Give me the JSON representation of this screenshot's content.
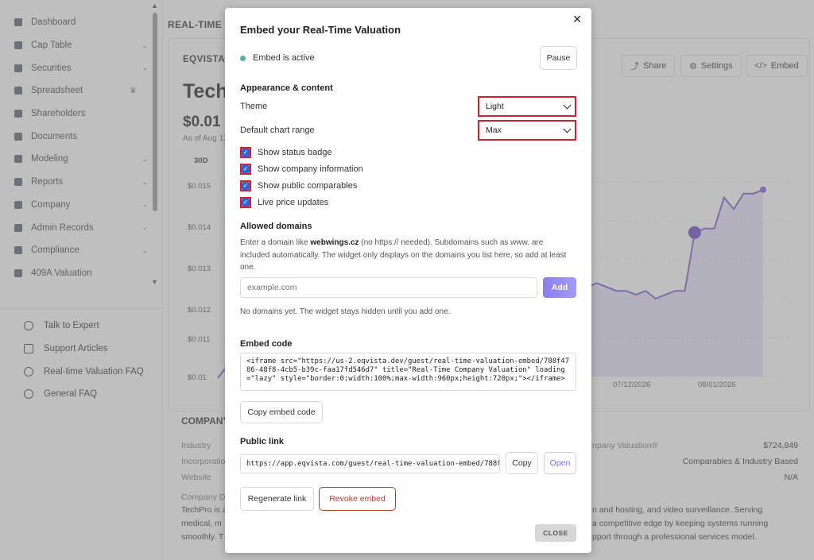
{
  "sidebar": {
    "items": [
      {
        "label": "Dashboard",
        "chevron": false
      },
      {
        "label": "Cap Table",
        "chevron": true
      },
      {
        "label": "Securities",
        "chevron": true
      },
      {
        "label": "Spreadsheet",
        "chevron": false,
        "crown": true
      },
      {
        "label": "Shareholders",
        "chevron": false
      },
      {
        "label": "Documents",
        "chevron": false
      },
      {
        "label": "Modeling",
        "chevron": true
      },
      {
        "label": "Reports",
        "chevron": true
      },
      {
        "label": "Company",
        "chevron": true
      },
      {
        "label": "Admin Records",
        "chevron": true
      },
      {
        "label": "Compliance",
        "chevron": true
      },
      {
        "label": "409A Valuation",
        "chevron": false
      }
    ],
    "help": [
      {
        "label": "Talk to Expert",
        "icon": "headset-icon"
      },
      {
        "label": "Support Articles",
        "icon": "book-icon"
      },
      {
        "label": "Real-time Valuation FAQ",
        "icon": "question-icon"
      },
      {
        "label": "General FAQ",
        "icon": "question-icon"
      }
    ]
  },
  "main": {
    "title": "REAL-TIME C",
    "card_label": "EQVISTA R",
    "company": "Tech",
    "price": "$0.01",
    "as_of": "As of Aug 12",
    "range": "30D",
    "buttons": {
      "share": "Share",
      "settings": "Settings",
      "embed": "Embed"
    },
    "y_ticks": [
      "$0.015",
      "$0.014",
      "$0.013",
      "$0.012",
      "$0.011",
      "$0.01"
    ],
    "x_ticks": [
      "07/12/2026",
      "08/01/2026"
    ],
    "info_title": "COMPANY",
    "info_labels": [
      "Industry",
      "Incorporatio",
      "Website",
      "Company D"
    ],
    "right_label": "npany Valuation®",
    "right_values": [
      "$724,849",
      "Comparables & Industry Based",
      "N/A"
    ],
    "desc_lines": [
      "TechPro is a",
      "medical, m",
      "smoothly. T"
    ],
    "desc_right": [
      "n and hosting, and video surveillance. Serving",
      "a competitive edge by keeping systems running",
      "pport through a professional services model."
    ]
  },
  "chart_data": {
    "type": "line",
    "ylim": [
      0.01,
      0.015
    ],
    "y_ticks": [
      0.015,
      0.014,
      0.013,
      0.012,
      0.011,
      0.01
    ],
    "x_ticks": [
      "07/12/2026",
      "08/01/2026"
    ],
    "series": [
      {
        "values": [
          0.0121,
          0.0122,
          0.0124,
          0.0123,
          0.0124,
          0.0123,
          0.0124,
          0.0123,
          0.0122,
          0.0122,
          0.0121,
          0.0122,
          0.012,
          0.0121,
          0.0122,
          0.0122,
          0.0137,
          0.0138,
          0.0138,
          0.0146,
          0.0143,
          0.0147,
          0.0147,
          0.0148
        ]
      }
    ]
  },
  "modal": {
    "title": "Embed your Real-Time Valuation",
    "status": "Embed is active",
    "pause": "Pause",
    "appearance_heading": "Appearance & content",
    "theme_label": "Theme",
    "theme_value": "Light",
    "range_label": "Default chart range",
    "range_value": "Max",
    "checks": [
      {
        "label": "Show status badge"
      },
      {
        "label": "Show company information"
      },
      {
        "label": "Show public comparables"
      },
      {
        "label": "Live price updates"
      }
    ],
    "domains_heading": "Allowed domains",
    "help_pre": "Enter a domain like ",
    "help_bold": "webwings.cz",
    "help_post": " (no https:// needed). Subdomains such as www. are included automatically. The widget only displays on the domains you list here, so add at least one.",
    "domain_placeholder": "example.com",
    "add": "Add",
    "no_domains": "No domains yet. The widget stays hidden until you add one.",
    "embed_heading": "Embed code",
    "embed_code": "<iframe src=\"https://us-2.eqvista.dev/guest/real-time-valuation-embed/788f4786-48f8-4cb5-b39c-faa17fd546d7\" title=\"Real-Time Company Valuation\" loading=\"lazy\" style=\"border:0;width:100%;max-width:960px;height:720px;\"></iframe>",
    "copy_code": "Copy embed code",
    "public_heading": "Public link",
    "public_link": "https://app.eqvista.com/guest/real-time-valuation-embed/788fa",
    "copy": "Copy",
    "open": "Open",
    "regenerate": "Regenerate link",
    "revoke": "Revoke embed",
    "close": "CLOSE"
  }
}
